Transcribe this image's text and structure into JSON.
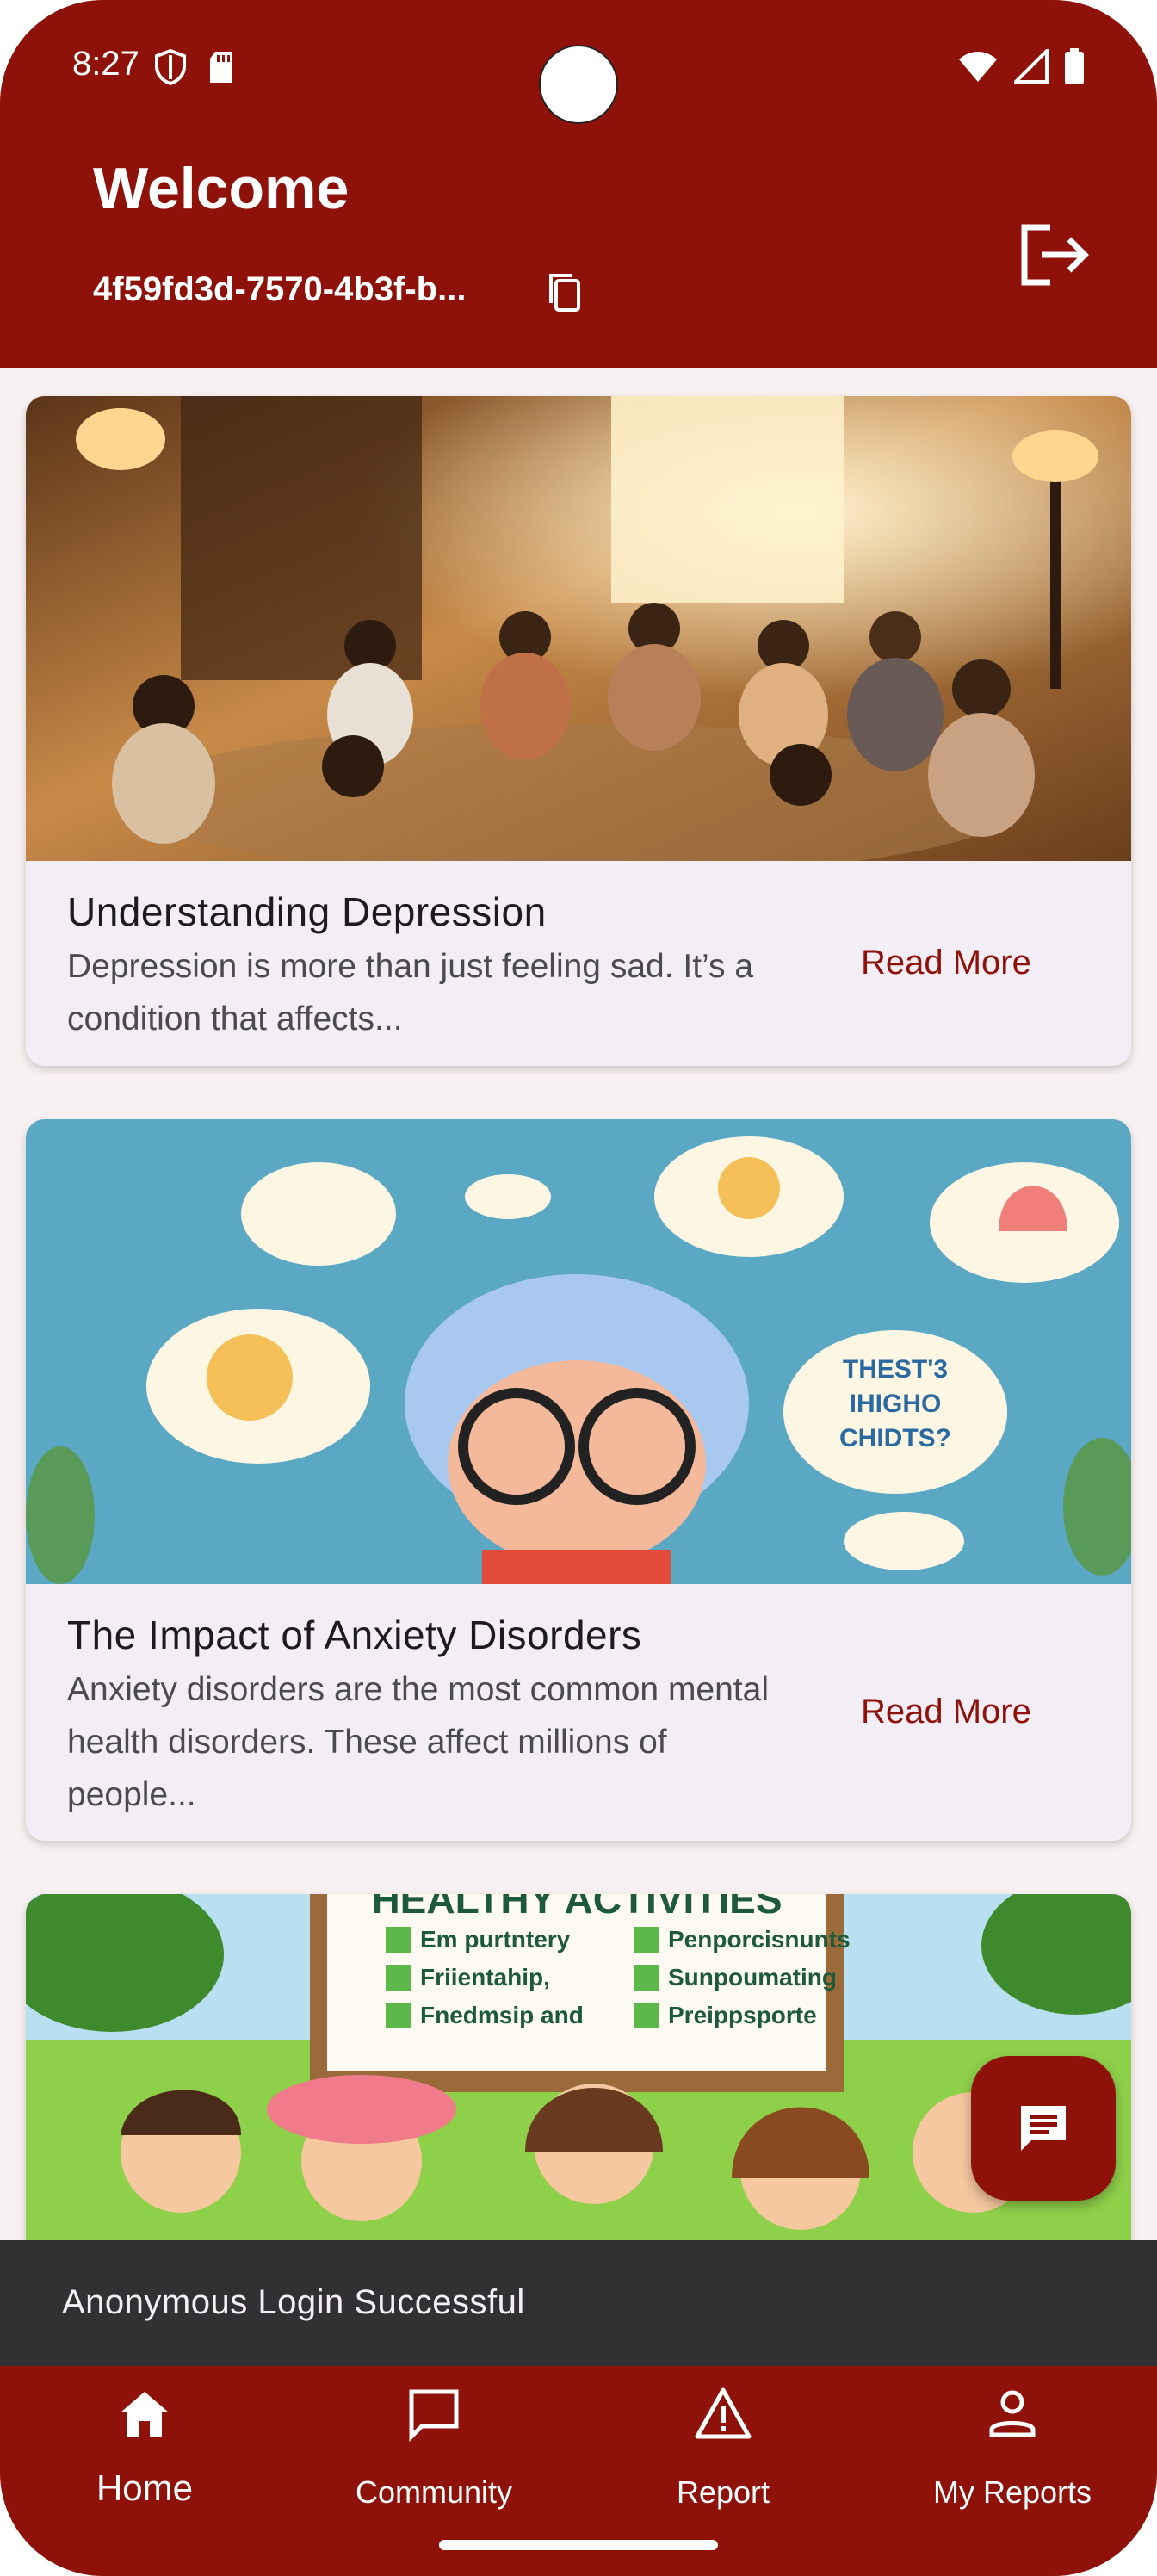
{
  "status_bar": {
    "time": "8:27"
  },
  "header": {
    "title": "Welcome",
    "user_id": "4f59fd3d-7570-4b3f-b...",
    "accent": "#8f120a"
  },
  "cards": [
    {
      "title": "Understanding Depression",
      "excerpt": "Depression is more than just feeling sad. It’s a condition that affects...",
      "action": "Read More"
    },
    {
      "title": "The Impact of Anxiety Disorders",
      "excerpt": "Anxiety disorders are the most common mental health disorders. These affect millions of people...",
      "action": "Read More",
      "image_text": [
        "THEST'3",
        "IHIGHO",
        "CHIDTS?"
      ]
    },
    {
      "image_text": {
        "banner": "HEALTHY ACTIVITIES",
        "items": [
          "Em purtntery",
          "Penporcisnunts",
          "Friientahip,",
          "Sunpoumating",
          "Fnedmsip and",
          "Preippsporte"
        ]
      }
    }
  ],
  "snackbar": {
    "message": "Anonymous Login Successful"
  },
  "bottom_nav": {
    "items": [
      {
        "label": "Home",
        "icon": "home-icon",
        "selected": true
      },
      {
        "label": "Community",
        "icon": "chat-bubble-icon"
      },
      {
        "label": "Report",
        "icon": "warning-icon"
      },
      {
        "label": "My Reports",
        "icon": "person-icon"
      }
    ]
  }
}
